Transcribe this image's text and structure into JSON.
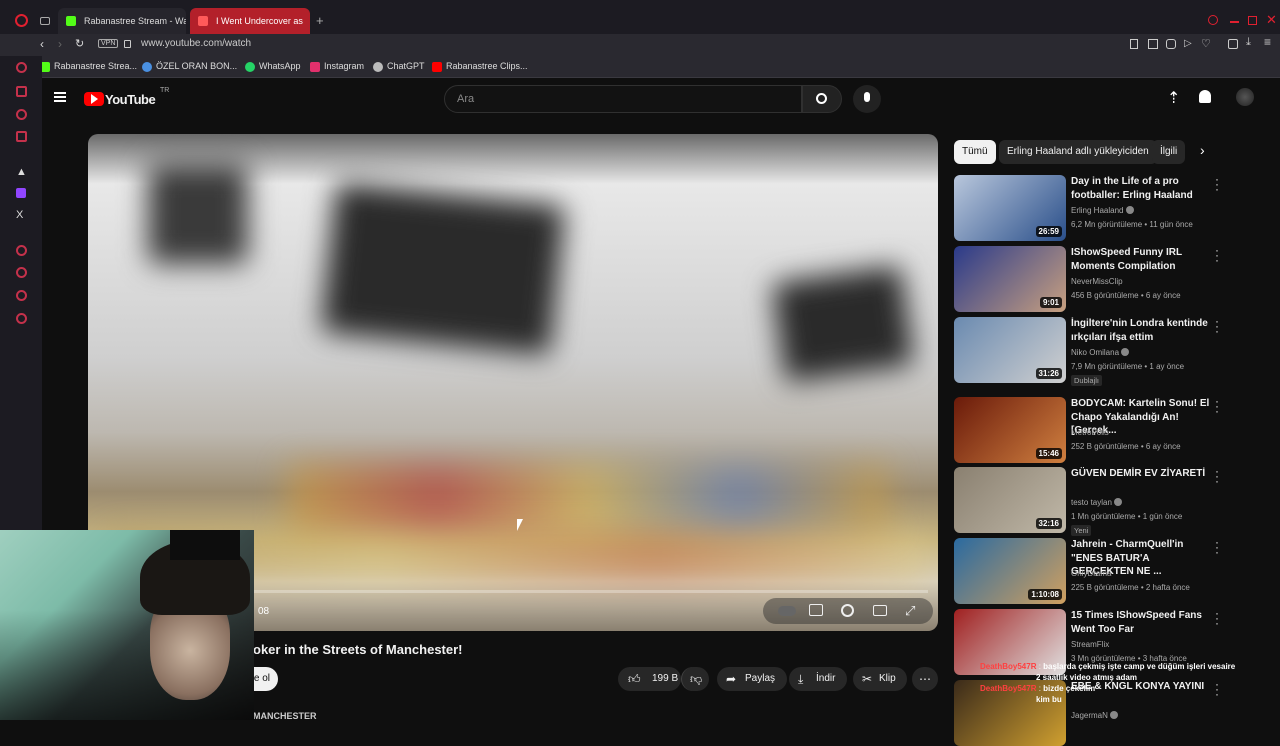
{
  "browser": {
    "tabs": [
      {
        "title": "Rabanastree Stream - Wa",
        "active": false,
        "color": "#53fc18"
      },
      {
        "title": "I Went Undercover as",
        "active": true,
        "color": "#ff0000"
      }
    ],
    "url": "www.youtube.com/watch",
    "vpn_label": "VPN",
    "bookmarks": [
      {
        "label": "Rabanastree Strea...",
        "color": "#53fc18"
      },
      {
        "label": "ÖZEL ORAN BON...",
        "color": "#4a90e2"
      },
      {
        "label": "WhatsApp",
        "color": "#25d366"
      },
      {
        "label": "Instagram",
        "color": "#e1306c"
      },
      {
        "label": "ChatGPT",
        "color": "#bbbbbb"
      },
      {
        "label": "Rabanastree Clips...",
        "color": "#ff0000"
      }
    ]
  },
  "youtube": {
    "logo_text": "YouTube",
    "region": "TR",
    "search_placeholder": "Ara",
    "video": {
      "time_fragment": "08",
      "title": "oker in the Streets of Manchester!",
      "subscribe_fragment": "e ol",
      "channel_fragment": "MANCHESTER"
    },
    "actions": {
      "likes": "199 B",
      "share": "Paylaş",
      "download": "İndir",
      "clip": "Klip"
    },
    "chips": [
      {
        "label": "Tümü",
        "active": true
      },
      {
        "label": "Erling Haaland adlı yükleyiciden",
        "active": false
      },
      {
        "label": "İlgili",
        "active": false
      }
    ],
    "recommendations": [
      {
        "title": "Day in the Life of a pro footballer: Erling Haaland",
        "channel": "Erling Haaland",
        "verified": true,
        "meta": "6,2 Mn görüntüleme • 11 gün önce",
        "duration": "26:59",
        "badge": "",
        "thumb": [
          "#b9c7dc",
          "#2a4f8a"
        ]
      },
      {
        "title": "IShowSpeed Funny IRL Moments Compilation",
        "channel": "NeverMissClip",
        "verified": false,
        "meta": "456 B görüntüleme • 6 ay önce",
        "duration": "9:01",
        "badge": "",
        "thumb": [
          "#2a3a8a",
          "#c8a080"
        ]
      },
      {
        "title": "İngiltere'nin Londra kentinde ırkçıları ifşa ettim",
        "channel": "Niko Omilana",
        "verified": true,
        "meta": "7,9 Mn görüntüleme • 1 ay önce",
        "duration": "31:26",
        "badge": "Dublajlı",
        "thumb": [
          "#6a8ab0",
          "#d0d0d0"
        ]
      },
      {
        "title": "BODYCAM: Kartelin Sonu! El Chapo Yakalandığı An! [Gerçek...",
        "channel": "MetroPolis",
        "verified": false,
        "meta": "252 B görüntüleme • 6 ay önce",
        "duration": "15:46",
        "badge": "",
        "thumb": [
          "#6a1a0a",
          "#d08040"
        ]
      },
      {
        "title": "GÜVEN DEMİR EV ZİYARETİ",
        "channel": "testo taylan",
        "verified": true,
        "meta": "1 Mn görüntüleme • 1 gün önce",
        "duration": "32:16",
        "badge": "Yeni",
        "thumb": [
          "#8a8070",
          "#c0b8a8"
        ]
      },
      {
        "title": "Jahrein - CharmQuell'in \"ENES BATUR'A GERÇEKTEN NE ...",
        "channel": "OnlyDrama",
        "verified": false,
        "meta": "225 B görüntüleme • 2 hafta önce",
        "duration": "1:10:08",
        "badge": "",
        "thumb": [
          "#2a6aa0",
          "#d0a060"
        ]
      },
      {
        "title": "15 Times IShowSpeed Fans Went Too Far",
        "channel": "StreamFlix",
        "verified": false,
        "meta": "3 Mn görüntüleme • 3 hafta önce",
        "duration": "",
        "badge": "",
        "thumb": [
          "#a02020",
          "#e0e0e0"
        ]
      },
      {
        "title": "EBE & KNGL KONYA YAYINI",
        "channel": "JagermaN",
        "verified": true,
        "meta": "",
        "duration": "",
        "badge": "",
        "thumb": [
          "#3a2a1a",
          "#d0a030"
        ]
      }
    ]
  },
  "stream_overlay": {
    "chat": [
      {
        "user": "DeathBoy547R",
        "text": "başlarda çekmiş işte camp ve düğüm işleri vesaire"
      },
      {
        "user": "",
        "text": "2 saatlik video atmış adam"
      },
      {
        "user": "DeathBoy547R",
        "text": "bizde çekelim"
      },
      {
        "user": "",
        "text": "kim bu"
      }
    ]
  }
}
